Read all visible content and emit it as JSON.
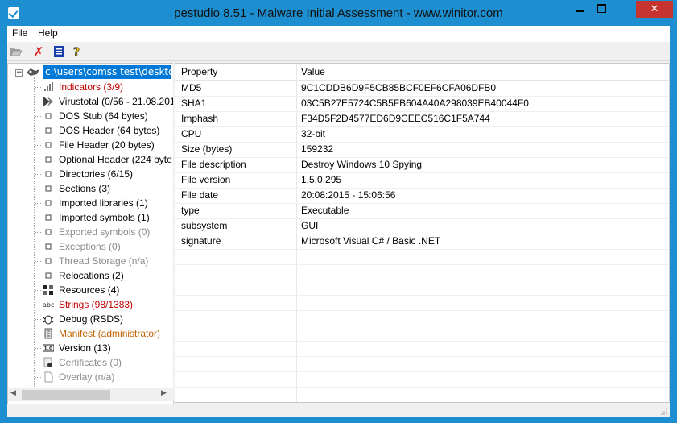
{
  "window": {
    "title": "pestudio 8.51 - Malware Initial Assessment - www.winitor.com"
  },
  "menu": {
    "file": "File",
    "help": "Help"
  },
  "toolbar": {
    "open": "open-folder-icon",
    "close": "close-icon",
    "list": "list-icon",
    "help": "help-icon"
  },
  "tree": {
    "root": "c:\\users\\comss test\\desktop\\d",
    "items": [
      {
        "label": "Indicators (3/9)",
        "icon": "indicators-icon",
        "color": "#c00000"
      },
      {
        "label": "Virustotal (0/56 - 21.08.201",
        "icon": "virustotal-icon",
        "color": "#000000"
      },
      {
        "label": "DOS Stub (64 bytes)",
        "icon": "node-icon",
        "color": "#000000"
      },
      {
        "label": "DOS Header (64 bytes)",
        "icon": "node-icon",
        "color": "#000000"
      },
      {
        "label": "File Header (20 bytes)",
        "icon": "node-icon",
        "color": "#000000"
      },
      {
        "label": "Optional Header (224 byte",
        "icon": "node-icon",
        "color": "#000000"
      },
      {
        "label": "Directories (6/15)",
        "icon": "node-icon",
        "color": "#000000"
      },
      {
        "label": "Sections (3)",
        "icon": "node-icon",
        "color": "#000000"
      },
      {
        "label": "Imported libraries (1)",
        "icon": "node-icon",
        "color": "#000000"
      },
      {
        "label": "Imported symbols (1)",
        "icon": "node-icon",
        "color": "#000000"
      },
      {
        "label": "Exported symbols (0)",
        "icon": "node-icon",
        "color": "#8a8a8a"
      },
      {
        "label": "Exceptions (0)",
        "icon": "node-icon",
        "color": "#8a8a8a"
      },
      {
        "label": "Thread Storage (n/a)",
        "icon": "node-icon",
        "color": "#8a8a8a"
      },
      {
        "label": "Relocations (2)",
        "icon": "node-icon",
        "color": "#000000"
      },
      {
        "label": "Resources (4)",
        "icon": "resources-icon",
        "color": "#000000"
      },
      {
        "label": "Strings (98/1383)",
        "icon": "strings-icon",
        "color": "#c00000"
      },
      {
        "label": "Debug (RSDS)",
        "icon": "debug-icon",
        "color": "#000000"
      },
      {
        "label": "Manifest (administrator)",
        "icon": "manifest-icon",
        "color": "#c06000"
      },
      {
        "label": "Version (13)",
        "icon": "version-icon",
        "color": "#000000"
      },
      {
        "label": "Certificates (0)",
        "icon": "certificate-icon",
        "color": "#8a8a8a"
      },
      {
        "label": "Overlay (n/a)",
        "icon": "overlay-icon",
        "color": "#8a8a8a"
      }
    ]
  },
  "grid": {
    "headers": {
      "property": "Property",
      "value": "Value"
    },
    "rows": [
      {
        "property": "MD5",
        "value": "9C1CDDB6D9F5CB85BCF0EF6CFA06DFB0"
      },
      {
        "property": "SHA1",
        "value": "03C5B27E5724C5B5FB604A40A298039EB40044F0"
      },
      {
        "property": "Imphash",
        "value": "F34D5F2D4577ED6D9CEEC516C1F5A744"
      },
      {
        "property": "CPU",
        "value": "32-bit"
      },
      {
        "property": "Size (bytes)",
        "value": "159232"
      },
      {
        "property": "File description",
        "value": "Destroy Windows 10 Spying"
      },
      {
        "property": "File version",
        "value": "1.5.0.295"
      },
      {
        "property": "File date",
        "value": "20:08:2015 - 15:06:56"
      },
      {
        "property": "type",
        "value": "Executable"
      },
      {
        "property": "subsystem",
        "value": "GUI"
      },
      {
        "property": "signature",
        "value": "Microsoft Visual C# / Basic .NET"
      }
    ]
  },
  "colors": {
    "titlebar": "#1d8fd0",
    "selection": "#0078d7",
    "close_button": "#c7332f"
  }
}
